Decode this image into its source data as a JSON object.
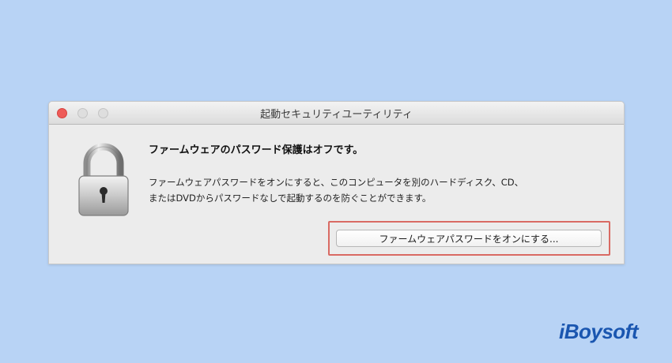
{
  "window": {
    "title": "起動セキュリティユーティリティ",
    "heading": "ファームウェアのパスワード保護はオフです。",
    "description_line1": "ファームウェアパスワードをオンにすると、このコンピュータを別のハードディスク、CD、",
    "description_line2": "またはDVDからパスワードなしで起動するのを防ぐことができます。",
    "button_label": "ファームウェアパスワードをオンにする..."
  },
  "watermark": {
    "text": "iBoysoft"
  },
  "colors": {
    "background": "#b8d3f5",
    "highlight": "#d96a63",
    "brand": "#1a56b0",
    "close_button": "#ee5b58"
  },
  "icons": [
    "lock-icon"
  ]
}
